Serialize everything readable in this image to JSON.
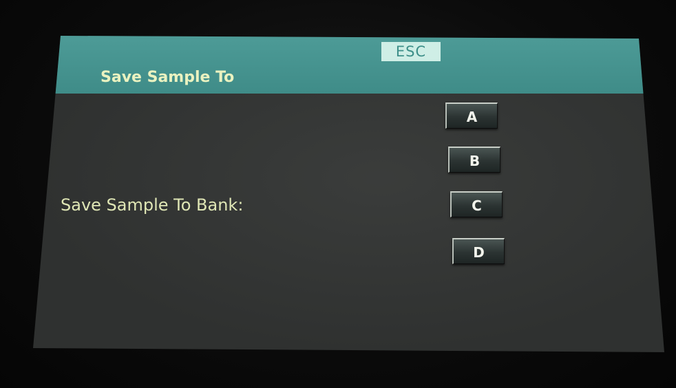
{
  "header": {
    "title": "Save Sample To",
    "esc_label": "ESC"
  },
  "main": {
    "prompt_label": "Save Sample To Bank:",
    "banks": [
      {
        "label": "A"
      },
      {
        "label": "B"
      },
      {
        "label": "C"
      },
      {
        "label": "D"
      }
    ]
  },
  "colors": {
    "header_bg": "#4d9b97",
    "screen_bg": "#2f3130",
    "text_primary": "#dfe6b5",
    "esc_bg": "#cfeee6",
    "esc_text": "#3d8f89"
  }
}
